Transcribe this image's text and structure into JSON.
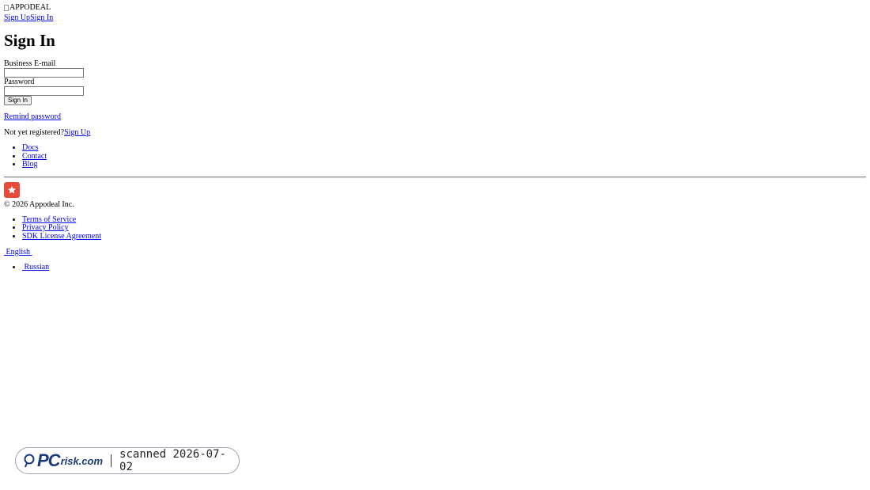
{
  "header": {
    "logo_alt": "APPODEAL",
    "signup_link": "Sign Up",
    "signin_link": "Sign In"
  },
  "form": {
    "title": "Sign In",
    "email_label": "Business E-mail",
    "email_value": "",
    "password_label": "Password",
    "password_value": "",
    "submit_label": "Sign In"
  },
  "links": {
    "remind_password": "Remind password",
    "not_registered": "Not yet registered?",
    "signup": "Sign Up"
  },
  "nav": {
    "items": [
      {
        "label": "Docs"
      },
      {
        "label": "Contact"
      },
      {
        "label": "Blog"
      }
    ]
  },
  "footer": {
    "brand_icon": "star-icon",
    "brand_color": "#e64a3b",
    "copyright": "© 2026 Appodeal Inc.",
    "legal": [
      {
        "label": "Terms of Service"
      },
      {
        "label": "Privacy Policy"
      },
      {
        "label": "SDK License Agreement"
      }
    ],
    "language_current": " English ",
    "language_options": [
      {
        "label": " Russian"
      }
    ]
  },
  "scan_badge": {
    "logo_pc": "PC",
    "logo_rest": "risk.com",
    "text": "scanned 2026-07-02"
  }
}
